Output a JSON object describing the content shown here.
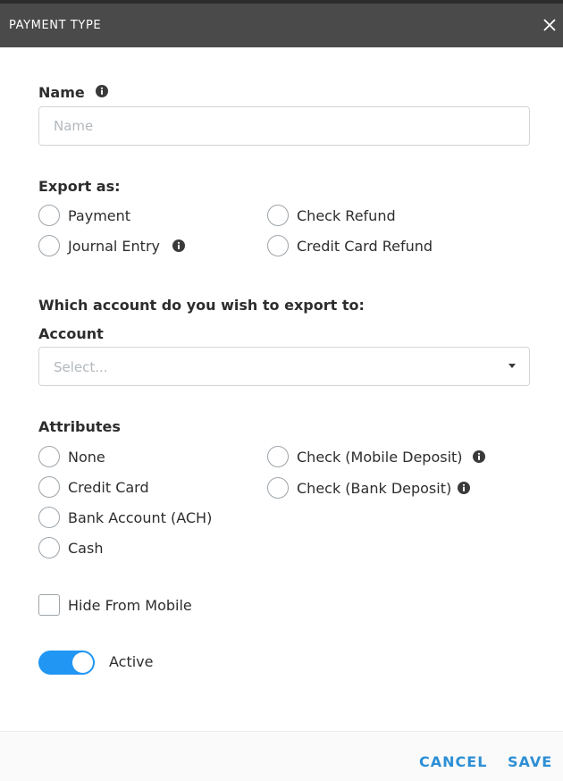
{
  "dialog": {
    "title": "PAYMENT TYPE",
    "close_icon": "close-icon"
  },
  "name_field": {
    "label": "Name",
    "info_icon": "info-icon",
    "value": "",
    "placeholder": "Name"
  },
  "export_as": {
    "label": "Export as:",
    "options": [
      {
        "label": "Payment",
        "selected": false
      },
      {
        "label": "Journal Entry",
        "selected": false,
        "has_info": true
      },
      {
        "label": "Check Refund",
        "selected": false
      },
      {
        "label": "Credit Card Refund",
        "selected": false
      }
    ]
  },
  "account": {
    "question": "Which account do you wish to export to:",
    "label": "Account",
    "placeholder": "Select...",
    "caret_icon": "caret-down-icon"
  },
  "attributes": {
    "label": "Attributes",
    "options": [
      {
        "label": "None",
        "selected": false
      },
      {
        "label": "Credit Card",
        "selected": false
      },
      {
        "label": "Bank Account (ACH)",
        "selected": false
      },
      {
        "label": "Cash",
        "selected": false
      },
      {
        "label": "Check (Mobile Deposit)",
        "selected": false,
        "has_info": true
      },
      {
        "label": "Check (Bank Deposit)",
        "selected": false,
        "has_info": true
      }
    ]
  },
  "hide_from_mobile": {
    "label": "Hide From Mobile",
    "checked": false
  },
  "active_toggle": {
    "label": "Active",
    "on": true,
    "color": "#2196f3"
  },
  "footer": {
    "cancel_label": "CANCEL",
    "save_label": "SAVE",
    "accent": "#2d8fd5"
  }
}
